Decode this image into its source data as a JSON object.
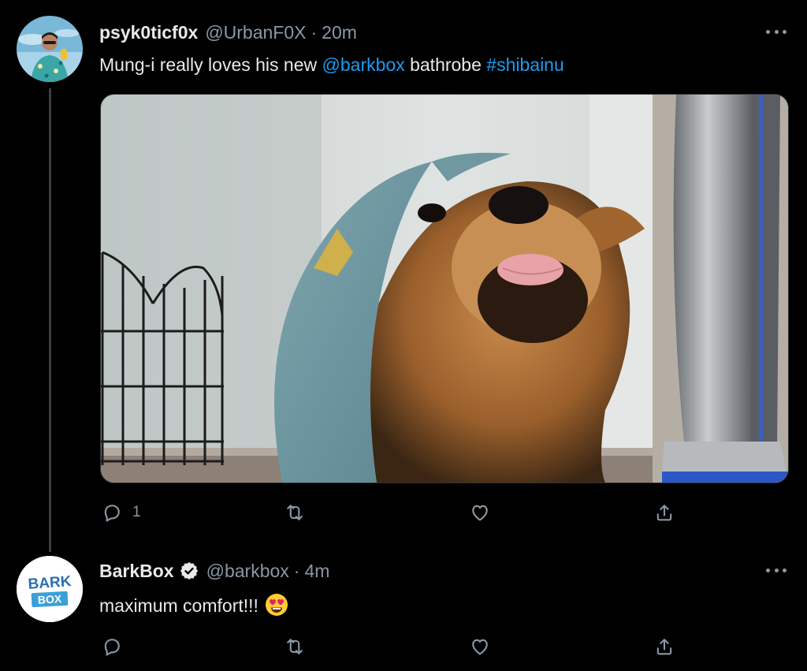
{
  "tweets": [
    {
      "display_name": "psyk0ticf0x",
      "handle": "@UrbanF0X",
      "separator": "·",
      "time": "20m",
      "text_prefix": "Mung-i really loves his new ",
      "mention": "@barkbox",
      "text_middle": " bathrobe ",
      "hashtag": "#shibainu",
      "reply_count": "1",
      "retweet_count": "",
      "like_count": ""
    },
    {
      "display_name": "BarkBox",
      "handle": "@barkbox",
      "separator": "·",
      "time": "4m",
      "text": "maximum comfort!!!",
      "emoji": "smiling-face-with-heart-eyes",
      "reply_count": "",
      "retweet_count": "",
      "like_count": ""
    }
  ],
  "logo": {
    "line1": "BARK",
    "line2": "BOX"
  },
  "colors": {
    "background": "#000000",
    "text": "#e7e9ea",
    "secondary": "#8b98a5",
    "link": "#1d9bf0",
    "thread_line": "#3a3f44",
    "verified": "#e7e9ea",
    "barkbox_blue": "#3aa0d8"
  },
  "icons": [
    "more-icon",
    "reply-icon",
    "retweet-icon",
    "like-icon",
    "share-icon",
    "verified-badge-icon"
  ]
}
